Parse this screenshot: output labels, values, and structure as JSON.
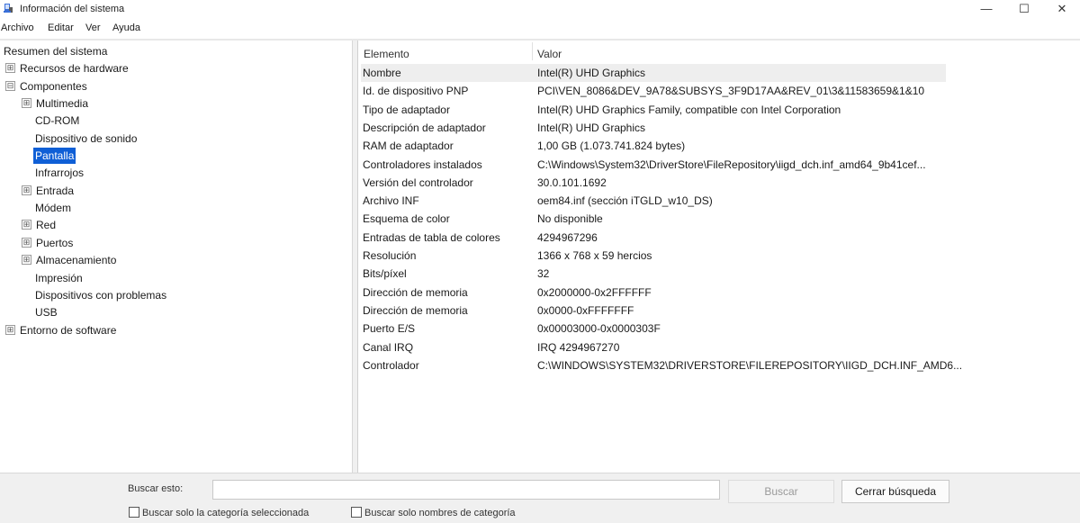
{
  "window": {
    "title": "Información del sistema",
    "controls": {
      "minimize": "—",
      "maximize": "☐",
      "close": "✕"
    }
  },
  "menu": [
    "Archivo",
    "Editar",
    "Ver",
    "Ayuda"
  ],
  "tree": {
    "root": "Resumen del sistema",
    "expanded_glyph": "⊟",
    "collapsed_glyph": "⊞",
    "hardware": "Recursos de hardware",
    "components": "Componentes",
    "multimedia": "Multimedia",
    "cdrom": "CD-ROM",
    "sound": "Dispositivo de sonido",
    "display": "Pantalla",
    "infrared": "Infrarrojos",
    "input": "Entrada",
    "modem": "Módem",
    "network": "Red",
    "ports": "Puertos",
    "storage": "Almacenamiento",
    "printing": "Impresión",
    "problem_devices": "Dispositivos con problemas",
    "usb": "USB",
    "software": "Entorno de software"
  },
  "details": {
    "columns": {
      "element": "Elemento",
      "value": "Valor"
    },
    "rows": [
      {
        "k": "Nombre",
        "v": "Intel(R) UHD Graphics"
      },
      {
        "k": "Id. de dispositivo PNP",
        "v": "PCI\\VEN_8086&DEV_9A78&SUBSYS_3F9D17AA&REV_01\\3&11583659&1&10"
      },
      {
        "k": "Tipo de adaptador",
        "v": "Intel(R) UHD Graphics Family, compatible con Intel Corporation"
      },
      {
        "k": "Descripción de adaptador",
        "v": "Intel(R) UHD Graphics"
      },
      {
        "k": "RAM de adaptador",
        "v": "1,00 GB (1.073.741.824 bytes)"
      },
      {
        "k": "Controladores instalados",
        "v": "C:\\Windows\\System32\\DriverStore\\FileRepository\\iigd_dch.inf_amd64_9b41cef..."
      },
      {
        "k": "Versión del controlador",
        "v": "30.0.101.1692"
      },
      {
        "k": "Archivo INF",
        "v": "oem84.inf (sección iTGLD_w10_DS)"
      },
      {
        "k": "Esquema de color",
        "v": "No disponible"
      },
      {
        "k": "Entradas de tabla de colores",
        "v": "4294967296"
      },
      {
        "k": "Resolución",
        "v": "1366 x 768 x 59 hercios"
      },
      {
        "k": "Bits/píxel",
        "v": "32"
      },
      {
        "k": "Dirección de memoria",
        "v": "0x2000000-0x2FFFFFF"
      },
      {
        "k": "Dirección de memoria",
        "v": "0x0000-0xFFFFFFF"
      },
      {
        "k": "Puerto E/S",
        "v": "0x00003000-0x0000303F"
      },
      {
        "k": "Canal IRQ",
        "v": "IRQ 4294967270"
      },
      {
        "k": "Controlador",
        "v": "C:\\WINDOWS\\SYSTEM32\\DRIVERSTORE\\FILEREPOSITORY\\IIGD_DCH.INF_AMD6..."
      }
    ]
  },
  "search": {
    "label": "Buscar esto:",
    "value": "",
    "find_button": "Buscar",
    "close_button": "Cerrar búsqueda",
    "option_selected_category": "Buscar solo la categoría seleccionada",
    "option_category_names": "Buscar solo nombres de categoría"
  }
}
